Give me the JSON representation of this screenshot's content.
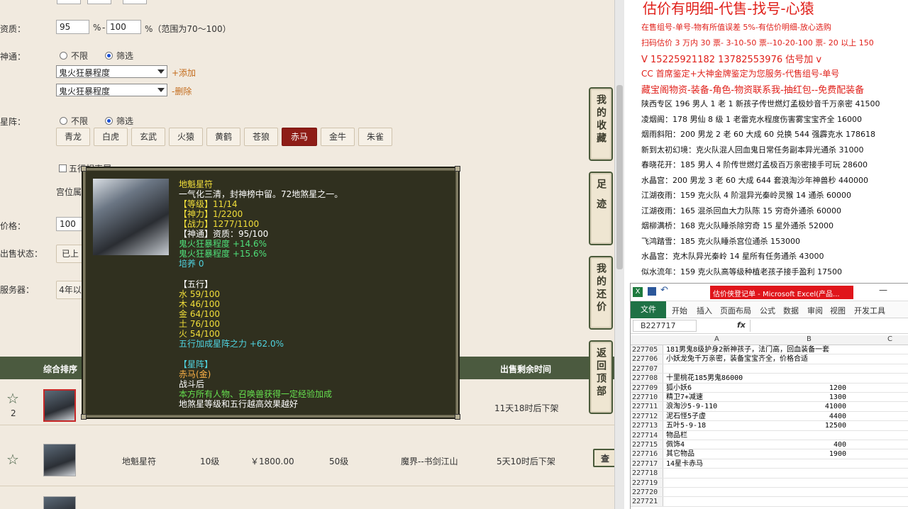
{
  "filters": {
    "aptitude_label": "资质：",
    "aptitude_min": "95",
    "aptitude_max": "100",
    "percent_sign": "%",
    "dash": "-",
    "aptitude_hint": "%（范围为70～100）",
    "skill_label": "神通：",
    "radio_unlimited": "不限",
    "radio_filter": "筛选",
    "skill_select_1": "鬼火狂暴程度",
    "skill_select_2": "鬼火狂暴程度",
    "add_link": "+添加",
    "delete_link": "-删除",
    "star_label": "星阵：",
    "star_buttons": [
      "青龙",
      "白虎",
      "玄武",
      "火猿",
      "黄鹤",
      "苍狼",
      "赤马",
      "金牛",
      "朱雀"
    ],
    "five_elements_checkbox": "五行相克属",
    "palace_label": "宫位属",
    "price_label": "价格：",
    "price_min": "100",
    "sale_status_label": "出售状态：",
    "sale_status_btn": "已上",
    "server_label": "服务器：",
    "server_btn": "4年以"
  },
  "table": {
    "header_sort": "综合排序",
    "header_remaining": "出售剩余时间",
    "rows": [
      {
        "fav_count": "2",
        "remaining": "11天18时后下架"
      },
      {
        "name": "地魁星符",
        "level": "10级",
        "price": "￥1800.00",
        "grade": "50级",
        "server": "魔界--书剑江山",
        "remaining": "5天10时后下架",
        "action": "查"
      }
    ]
  },
  "side_tabs": [
    "我的收藏",
    "足迹",
    "我的还价",
    "返回顶部"
  ],
  "tooltip": {
    "title": "地魁星符",
    "desc": "一气化三清，封神榜中留。72地煞星之一。",
    "level": "【等级】11/14",
    "power": "【神力】1/2200",
    "combat": "【战力】1277/1100",
    "aptitude": "【神通】资质：95/100",
    "skill1": "鬼火狂暴程度 +14.6%",
    "skill2": "鬼火狂暴程度 +15.6%",
    "cultivate": "培养 0",
    "five_header": "【五行】",
    "water": "水 59/100",
    "wood": "木 46/100",
    "metal": "金 64/100",
    "earth": "土 76/100",
    "fire": "火 54/100",
    "five_bonus": "五行加成星阵之力 +62.0%",
    "star_header": "【星阵】",
    "star_name": "赤马(金)",
    "star_pos": "战斗后",
    "star_effect": "本方所有人物、召唤兽获得一定经验加成",
    "star_note": "地煞星等级和五行越高效果越好"
  },
  "notes": {
    "title": "估价有明细-代售-找号-心猿",
    "line1": "在售组号-单号-物有所值误差 5%-有估价明细-放心选购",
    "line2": "扫码估价 3 万内 30 票- 3-10-50 票--10-20-100 票- 20 以上 150",
    "line3": "V 15225921182    13782553976    估号加 v",
    "line4": "CC 首席鉴定+大神金牌鉴定为您服务-代售组号-单号",
    "line5": "藏宝阁物资-装备-角色-物资联系我-抽红包--免费配装备",
    "items": [
      "陕西专区 196 男人 1 老 1 新孩子传世燃灯孟极妙音千万亲密 41500",
      "凌烟阁：178 男仙 8 级 1 老雷克水程度伤害雾宝宝齐全 16000",
      "烟雨斜阳：200 男龙 2 老 60 大成 60 兑换 544 强霹克水 178618",
      "新到太初幻境：克火队混人回血鬼日常任务副本异光通杀 31000",
      "春晓花开：185 男人 4 阶传世燃灯孟极百万亲密接手可玩 28600",
      "水晶宫：200 男龙 3 老 60 大成 644 套浪淘沙年神兽秒 440000",
      "江湖夜雨：159 克火队 4 阶混异光秦岭灵猴 14 通杀 60000",
      "江湖夜雨：165 混杀回血大力队陈 15 穷奇外通杀 60000",
      "烟柳满桥：168 克火队睡杀除穷奇 15 星外通杀 52000",
      "飞鸿踏雪：185 克火队睡杀宫位通杀 153000",
      "水晶宫：克木队异光秦岭 14 星所有任务通杀 43000",
      "似水流年：159 克火队高等级种植老孩子接手盈利 17500"
    ]
  },
  "excel": {
    "title": "估价侠登记单 - Microsoft Excel(产品...",
    "tabs": [
      "文件",
      "开始",
      "插入",
      "页面布局",
      "公式",
      "数据",
      "审阅",
      "视图",
      "开发工具"
    ],
    "cell_ref": "B227717",
    "fx": "fx",
    "col_a": "A",
    "col_b": "B",
    "col_c": "C",
    "rows": [
      {
        "n": "227705",
        "a": "181男鬼8级护身2新神孩子，法门高，回血装备一套",
        "b": ""
      },
      {
        "n": "227706",
        "a": "小妖龙兔千万亲密，装备宝宝齐全，价格合适",
        "b": ""
      },
      {
        "n": "227707",
        "a": "",
        "b": ""
      },
      {
        "n": "227708",
        "a": "十里桃花185男鬼86000",
        "b": ""
      },
      {
        "n": "227709",
        "a": "狐小妖6",
        "b": "1200"
      },
      {
        "n": "227710",
        "a": "精卫7+减速",
        "b": "1300"
      },
      {
        "n": "227711",
        "a": "浪淘沙5-9-110",
        "b": "41000"
      },
      {
        "n": "227712",
        "a": "泥石怪5子虚",
        "b": "4400"
      },
      {
        "n": "227713",
        "a": "五叶5-9-18",
        "b": "12500"
      },
      {
        "n": "227714",
        "a": "物品栏",
        "b": ""
      },
      {
        "n": "227715",
        "a": "佩饰4",
        "b": "400"
      },
      {
        "n": "227716",
        "a": "其它物品",
        "b": "1900"
      },
      {
        "n": "227717",
        "a": "14星卡赤马",
        "b": ""
      },
      {
        "n": "227718",
        "a": "",
        "b": ""
      },
      {
        "n": "227719",
        "a": "",
        "b": ""
      },
      {
        "n": "227720",
        "a": "",
        "b": ""
      },
      {
        "n": "227721",
        "a": "",
        "b": ""
      }
    ]
  }
}
